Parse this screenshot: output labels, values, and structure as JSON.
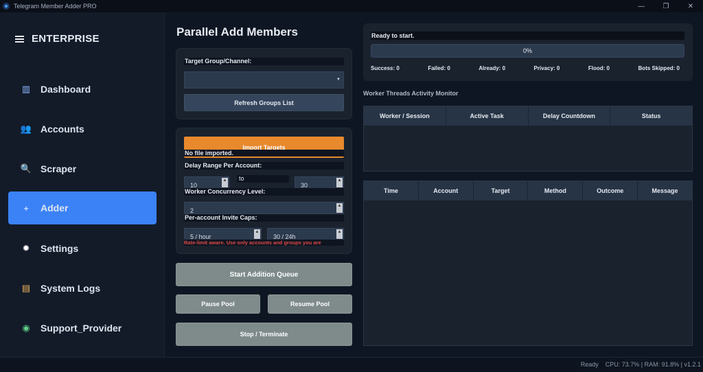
{
  "window": {
    "title": "Telegram Member Adder PRO",
    "minimize": "—",
    "maximize": "❐",
    "close": "✕"
  },
  "sidebar": {
    "brand": "ENTERPRISE",
    "items": [
      {
        "label": "Dashboard",
        "icon": "dashboard-icon",
        "glyph": "▥",
        "color": "#8fb8ff"
      },
      {
        "label": "Accounts",
        "icon": "users-icon",
        "glyph": "👥",
        "color": "#8fb8ff"
      },
      {
        "label": "Scraper",
        "icon": "search-icon",
        "glyph": "🔍",
        "color": "#8fb8ff"
      },
      {
        "label": "Adder",
        "icon": "plus-icon",
        "glyph": "+",
        "color": "#ffffff",
        "active": true
      },
      {
        "label": "Settings",
        "icon": "gear-icon",
        "glyph": "✹",
        "color": "#ffffff"
      },
      {
        "label": "System Logs",
        "icon": "log-icon",
        "glyph": "▤",
        "color": "#f0b45a"
      },
      {
        "label": "Support_Provider",
        "icon": "support-icon",
        "glyph": "◉",
        "color": "#5fd08a"
      }
    ]
  },
  "main": {
    "title": "Parallel Add Members",
    "target": {
      "label": "Target Group/Channel:",
      "select_value": "",
      "refresh_button": "Refresh Groups List"
    },
    "import": {
      "button": "Import Targets",
      "status": "No file imported.",
      "delay_label": "Delay Range Per Account:",
      "delay_min": "10",
      "delay_to": "to",
      "delay_max": "30",
      "concurrency_label": "Worker Concurrency Level:",
      "concurrency": "2",
      "caps_label": "Per-account Invite Caps:",
      "cap_hour": "5 / hour",
      "cap_day": "30 / 24h",
      "warning": "Rate-limit aware. Use only accounts and groups you are"
    },
    "start_button": "Start Addition Queue",
    "pause_button": "Pause Pool",
    "resume_button": "Resume Pool",
    "stop_button": "Stop / Terminate"
  },
  "status": {
    "message": "Ready to start.",
    "progress_text": "0%",
    "progress": 0,
    "stats": [
      "Success: 0",
      "Failed: 0",
      "Already: 0",
      "Privacy: 0",
      "Flood: 0",
      "Bots Skipped: 0"
    ]
  },
  "monitor": {
    "title": "Worker Threads Activity Monitor",
    "columns": [
      "Worker / Session",
      "Active Task",
      "Delay Countdown",
      "Status"
    ]
  },
  "log_table": {
    "columns": [
      "Time",
      "Account",
      "Target",
      "Method",
      "Outcome",
      "Message"
    ]
  },
  "statusbar": {
    "text": "Ready    CPU: 73.7% | RAM: 91.8% | v1.2.1"
  },
  "colors": {
    "accent": "#3b82f6",
    "import": "#e8892d",
    "warning": "#e04848",
    "button_grey": "#7f8b8b"
  }
}
